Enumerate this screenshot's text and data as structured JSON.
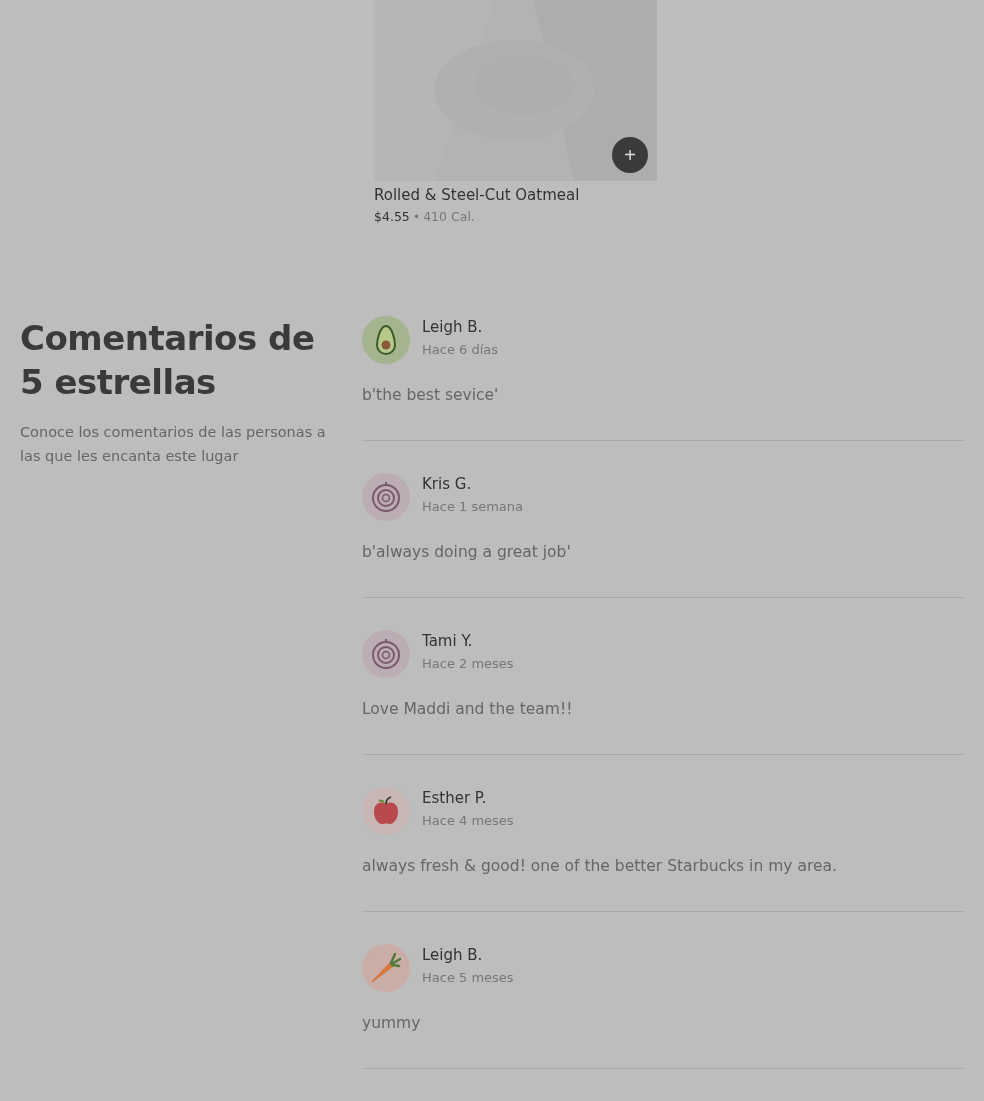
{
  "menu_item": {
    "kind": "picture",
    "name": "Rolled & Steel-Cut Oatmeal",
    "price": "$4.55",
    "separator": "•",
    "calories": "410 Cal.",
    "add_button": "+"
  },
  "reviews_section": {
    "title": "Comentarios de 5 estrellas",
    "description": "Conoce los comentarios de las personas a las que les encanta este lugar",
    "reviews": [
      {
        "kind": "avocado",
        "name": "Leigh B.",
        "time": "Hace 6 días",
        "comment": "b'the best sevice'"
      },
      {
        "kind": "onion",
        "name": "Kris G.",
        "time": "Hace 1 semana",
        "comment": "b'always doing a great job'"
      },
      {
        "kind": "onion",
        "name": "Tami Y.",
        "time": "Hace 2 meses",
        "comment": "Love Maddi and the team!!"
      },
      {
        "kind": "apple",
        "name": "Esther P.",
        "time": "Hace 4 meses",
        "comment": "always fresh & good! one of the better Starbucks in my area."
      },
      {
        "kind": "carrot",
        "name": "Leigh B.",
        "time": "Hace 5 meses",
        "comment": "yummy"
      }
    ]
  }
}
